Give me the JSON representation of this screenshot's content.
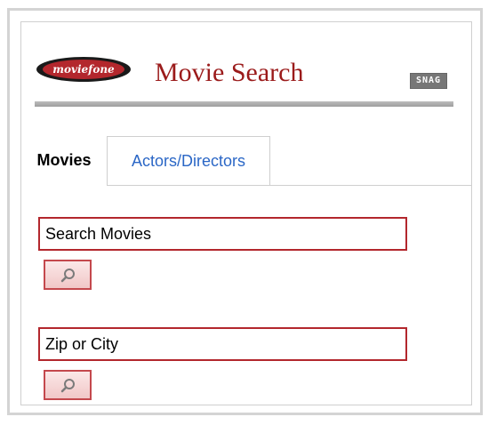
{
  "header": {
    "logo_text": "moviefone",
    "title": "Movie Search",
    "badge": "SNAG"
  },
  "tabs": [
    {
      "label": "Movies",
      "active": true
    },
    {
      "label": "Actors/Directors",
      "active": false
    }
  ],
  "search": {
    "movies_placeholder": "Search Movies",
    "location_placeholder": "Zip or City"
  },
  "icons": {
    "logo": "moviefone-logo",
    "search_button": "magnifier-icon"
  },
  "colors": {
    "brand_red": "#9b1b1b",
    "field_border": "#b3272d",
    "link_blue": "#2b67c6",
    "button_fill": "#f1c7c7"
  }
}
